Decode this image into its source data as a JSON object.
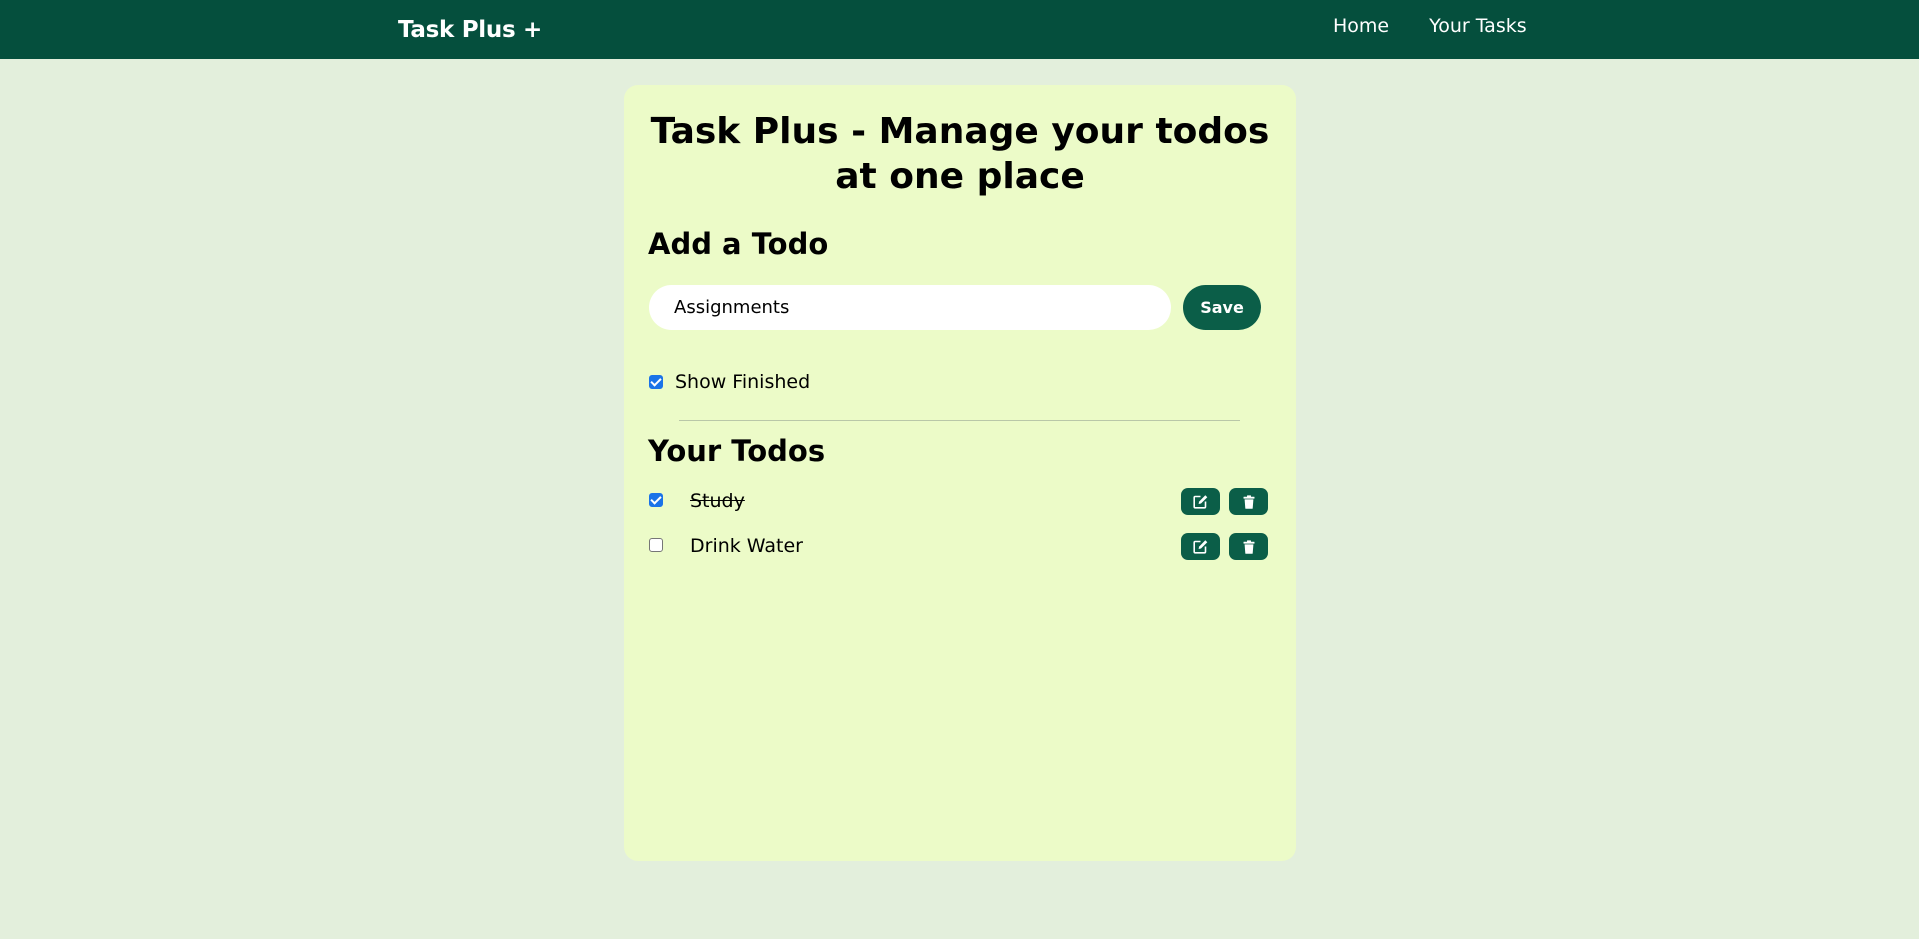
{
  "navbar": {
    "brand": "Task Plus +",
    "links": [
      {
        "label": "Home"
      },
      {
        "label": "Your Tasks"
      }
    ]
  },
  "main": {
    "title": "Task Plus - Manage your todos at one place",
    "add_heading": "Add a Todo",
    "input_value": "Assignments",
    "save_label": "Save",
    "show_finished": {
      "label": "Show Finished",
      "checked": true
    },
    "todos_heading": "Your Todos",
    "todos": [
      {
        "text": "Study",
        "completed": true
      },
      {
        "text": "Drink Water",
        "completed": false
      }
    ],
    "todo_action_icons": [
      "edit-icon",
      "trash-icon"
    ]
  },
  "colors": {
    "navbar_bg": "#054f3d",
    "page_bg": "#e3efdc",
    "card_bg": "#ecfbc8",
    "accent": "#0b5e48",
    "checkbox_checked": "#1a73e8"
  }
}
